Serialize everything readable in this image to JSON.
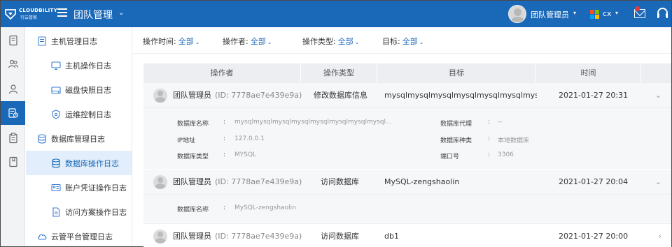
{
  "header": {
    "brand": "CLOUDBILITY",
    "brand_sub": "行云管家",
    "app_title": "团队管理",
    "user_name": "团队管理员",
    "org_label": "cx",
    "colors": {
      "bar": "#1a68b8",
      "accent": "#1a68b8"
    }
  },
  "rail": {
    "items": [
      {
        "icon": "document-icon"
      },
      {
        "icon": "users-group-icon"
      },
      {
        "icon": "user-icon"
      },
      {
        "icon": "audit-log-icon",
        "active": true
      },
      {
        "icon": "clipboard-icon"
      },
      {
        "icon": "book-icon"
      }
    ]
  },
  "sidenav": {
    "host_group": "主机管理日志",
    "host_ops": "主机操作日志",
    "disk_snapshot": "磁盘快照日志",
    "ops_control": "运维控制日志",
    "db_group": "数据库管理日志",
    "db_ops": "数据库操作日志",
    "account_ops": "账户凭证操作日志",
    "access_ops": "访问方案操作日志",
    "cloud_group": "云管平台管理日志"
  },
  "filters": [
    {
      "label": "操作时间:",
      "value": "全部"
    },
    {
      "label": "操作者:",
      "value": "全部"
    },
    {
      "label": "操作类型:",
      "value": "全部"
    },
    {
      "label": "目标:",
      "value": "全部"
    }
  ],
  "table": {
    "columns": [
      "操作者",
      "操作类型",
      "目标",
      "时间"
    ],
    "rows": [
      {
        "operator": "团队管理员",
        "id": "(ID: 7778ae7e439e9a)",
        "type": "修改数据库信息",
        "target": "mysqlmysqlmysqlmysqlmysqlmysqlmysqlmysqlm",
        "time": "2021-01-27 20:31",
        "expanded": true
      },
      {
        "operator": "团队管理员",
        "id": "(ID: 7778ae7e439e9a)",
        "type": "访问数据库",
        "target": "MySQL-zengshaolin",
        "time": "2021-01-27 20:04",
        "expanded": true
      },
      {
        "operator": "团队管理员",
        "id": "(ID: 7778ae7e439e9a)",
        "type": "访问数据库",
        "target": "db1",
        "time": "2021-01-27 20:00",
        "expanded": false
      }
    ],
    "detail1": {
      "db_name_label": "数据库名称",
      "db_name_value": "mysqlmysqlmysqlmysqlmysqlmysqlmysqlmysql...",
      "ip_label": "IP地址",
      "ip_value": "127.0.0.1",
      "db_type_label": "数据库类型",
      "db_type_value": "MYSQL",
      "proxy_label": "数据库代理",
      "proxy_value": "--",
      "kind_label": "数据库种类",
      "kind_value": "本地数据库",
      "port_label": "端口号",
      "port_value": "3306",
      "colon": ":"
    },
    "detail2": {
      "db_name_label": "数据库名称",
      "db_name_value": "MySQL-zengshaolin",
      "colon": ":"
    }
  }
}
